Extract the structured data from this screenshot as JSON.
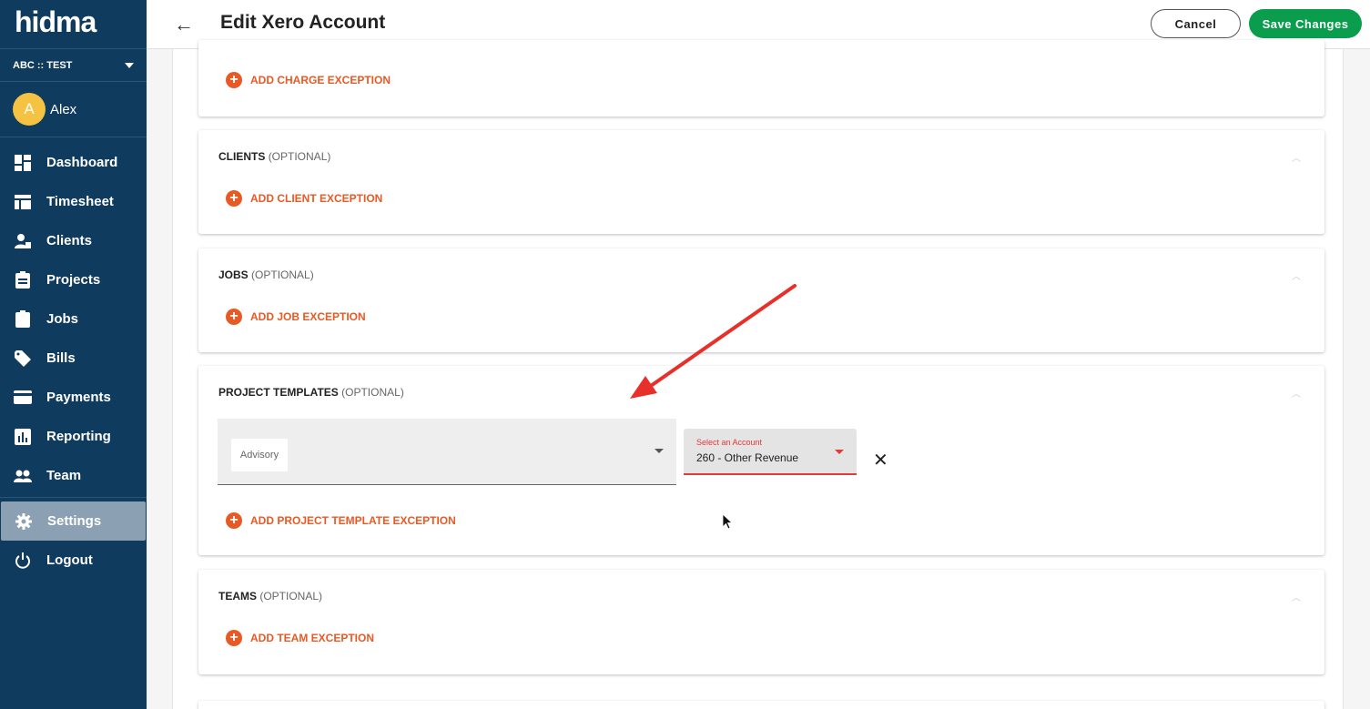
{
  "app": {
    "logo": "hidma",
    "org": "ABC :: TEST",
    "user_initial": "A",
    "user_name": "Alex"
  },
  "nav": [
    {
      "label": "Dashboard",
      "icon": "dashboard-icon"
    },
    {
      "label": "Timesheet",
      "icon": "table-icon"
    },
    {
      "label": "Clients",
      "icon": "clients-icon"
    },
    {
      "label": "Projects",
      "icon": "clipboard-icon"
    },
    {
      "label": "Jobs",
      "icon": "job-icon"
    },
    {
      "label": "Bills",
      "icon": "tag-icon"
    },
    {
      "label": "Payments",
      "icon": "card-icon"
    },
    {
      "label": "Reporting",
      "icon": "chart-icon"
    },
    {
      "label": "Team",
      "icon": "people-icon"
    },
    {
      "label": "Settings",
      "icon": "gear-icon",
      "active": true
    },
    {
      "label": "Logout",
      "icon": "power-icon"
    }
  ],
  "header": {
    "back": "←",
    "title": "Edit Xero Account",
    "cancel_label": "Cancel",
    "save_label": "Save Changes"
  },
  "sections": {
    "charges": {
      "add_label": "ADD CHARGE EXCEPTION"
    },
    "clients": {
      "title": "CLIENTS",
      "optional": "(OPTIONAL)",
      "add_label": "ADD CLIENT EXCEPTION"
    },
    "jobs": {
      "title": "JOBS",
      "optional": "(OPTIONAL)",
      "add_label": "ADD JOB EXCEPTION"
    },
    "project_templates": {
      "title": "PROJECT TEMPLATES",
      "optional": "(OPTIONAL)",
      "template_chip": "Advisory",
      "account_label": "Select an Account",
      "account_value": "260 - Other Revenue",
      "remove": "✕",
      "add_label": "ADD PROJECT TEMPLATE EXCEPTION"
    },
    "teams": {
      "title": "TEAMS",
      "optional": "(OPTIONAL)",
      "add_label": "ADD TEAM EXCEPTION"
    }
  },
  "colors": {
    "sidebar": "#0f3b5f",
    "accent": "#e85a25",
    "save": "#0a9d4d",
    "error": "#e53935",
    "annotation": "#e8302a"
  }
}
